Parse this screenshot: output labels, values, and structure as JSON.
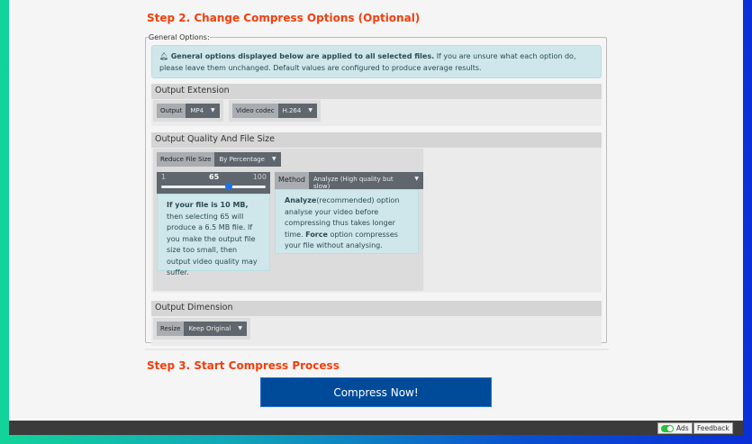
{
  "step2": {
    "title": "Step 2. Change Compress Options (Optional)",
    "legend": "General Options:",
    "info_bold": "General options displayed below are applied to all selected files.",
    "info_rest": " If you are unsure what each option do, please leave them unchanged. Default values are configured to produce average results."
  },
  "ext": {
    "title": "Output Extension",
    "output_label": "Output",
    "output_value": "MP4",
    "codec_label": "Video codec",
    "codec_value": "H.264"
  },
  "quality": {
    "title": "Output Quality And File Size",
    "reduce_label": "Reduce File Size",
    "reduce_value": "By Percentage",
    "slider": {
      "min": "1",
      "max": "100",
      "value": "65",
      "fraction": 0.65
    },
    "note_bold": "If your file is 10 MB,",
    "note_rest": " then selecting 65 will produce a 6.5 MB file. If you make the output file size too small, then output video quality may suffer.",
    "method_label": "Method",
    "method_value": "Analyze (High quality but slow)",
    "method_b1": "Analyze",
    "method_t1": "(recommended) option analyse your video before compressing thus takes longer time. ",
    "method_b2": "Force",
    "method_t2": " option compresses your file without analysing."
  },
  "dim": {
    "title": "Output Dimension",
    "resize_label": "Resize",
    "resize_value": "Keep Original"
  },
  "step3": {
    "title": "Step 3. Start Compress Process",
    "button": "Compress Now!"
  },
  "footer": {
    "ads": "Ads",
    "feedback": "Feedback",
    "ads_on": true,
    "toggle_color": "#2fbf3a"
  }
}
